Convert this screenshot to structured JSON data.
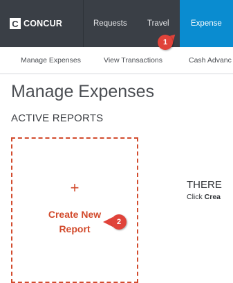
{
  "app": {
    "logo_mark": "C",
    "logo_text": "CONCUR"
  },
  "nav": {
    "items": [
      {
        "label": "Requests"
      },
      {
        "label": "Travel"
      },
      {
        "label": "Expense"
      }
    ],
    "active_color": "#0a8cd0",
    "bar_color": "#3a3f46"
  },
  "subnav": {
    "items": [
      {
        "label": "Manage Expenses"
      },
      {
        "label": "View Transactions"
      },
      {
        "label": "Cash Advanc"
      }
    ]
  },
  "page": {
    "title": "Manage Expenses",
    "section_title": "ACTIVE REPORTS"
  },
  "create_card": {
    "plus": "+",
    "label_line1": "Create New",
    "label_line2": "Report",
    "accent_color": "#d24b2d"
  },
  "empty_state": {
    "title": "THERE",
    "hint_prefix": "Click ",
    "hint_bold": "Crea"
  },
  "callouts": [
    {
      "number": "1"
    },
    {
      "number": "2"
    }
  ]
}
